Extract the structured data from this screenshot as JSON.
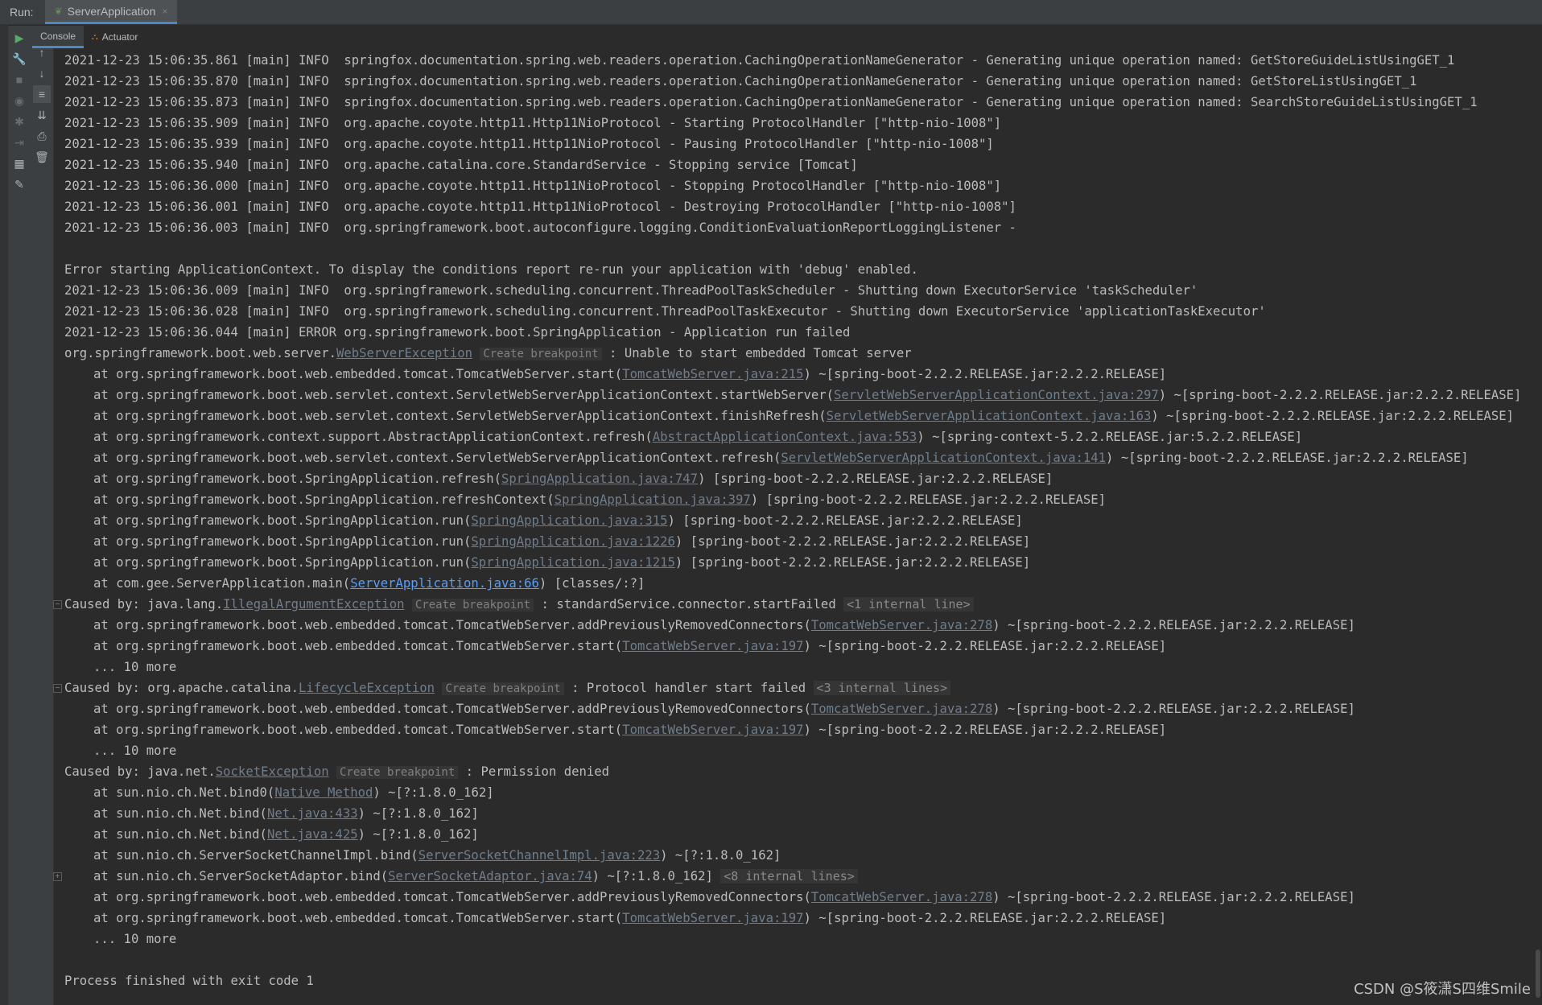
{
  "run": {
    "label": "Run:",
    "tab_title": "ServerApplication",
    "close_glyph": "×"
  },
  "subtabs": [
    {
      "label": "Console"
    },
    {
      "label": "Actuator"
    }
  ],
  "toolbar_icons": {
    "col1": [
      "run-icon",
      "wrench-icon",
      "stop-icon",
      "camera-icon",
      "debug-icon",
      "exit-icon",
      "layout-icon",
      "pin-icon"
    ],
    "col2": [
      "up-arrow-icon",
      "down-arrow-icon",
      "soft-wrap-icon",
      "scroll-to-end-icon",
      "print-icon",
      "trash-icon"
    ]
  },
  "console": {
    "lines": [
      {
        "t": "plain",
        "text": "2021-12-23 15:06:35.861 [main] INFO  springfox.documentation.spring.web.readers.operation.CachingOperationNameGenerator - Generating unique operation named: GetStoreGuideListUsingGET_1"
      },
      {
        "t": "plain",
        "text": "2021-12-23 15:06:35.870 [main] INFO  springfox.documentation.spring.web.readers.operation.CachingOperationNameGenerator - Generating unique operation named: GetStoreListUsingGET_1"
      },
      {
        "t": "plain",
        "text": "2021-12-23 15:06:35.873 [main] INFO  springfox.documentation.spring.web.readers.operation.CachingOperationNameGenerator - Generating unique operation named: SearchStoreGuideListUsingGET_1"
      },
      {
        "t": "plain",
        "text": "2021-12-23 15:06:35.909 [main] INFO  org.apache.coyote.http11.Http11NioProtocol - Starting ProtocolHandler [\"http-nio-1008\"]"
      },
      {
        "t": "plain",
        "text": "2021-12-23 15:06:35.939 [main] INFO  org.apache.coyote.http11.Http11NioProtocol - Pausing ProtocolHandler [\"http-nio-1008\"]"
      },
      {
        "t": "plain",
        "text": "2021-12-23 15:06:35.940 [main] INFO  org.apache.catalina.core.StandardService - Stopping service [Tomcat]"
      },
      {
        "t": "plain",
        "text": "2021-12-23 15:06:36.000 [main] INFO  org.apache.coyote.http11.Http11NioProtocol - Stopping ProtocolHandler [\"http-nio-1008\"]"
      },
      {
        "t": "plain",
        "text": "2021-12-23 15:06:36.001 [main] INFO  org.apache.coyote.http11.Http11NioProtocol - Destroying ProtocolHandler [\"http-nio-1008\"]"
      },
      {
        "t": "plain",
        "text": "2021-12-23 15:06:36.003 [main] INFO  org.springframework.boot.autoconfigure.logging.ConditionEvaluationReportLoggingListener -"
      },
      {
        "t": "plain",
        "text": ""
      },
      {
        "t": "plain",
        "text": "Error starting ApplicationContext. To display the conditions report re-run your application with 'debug' enabled."
      },
      {
        "t": "plain",
        "text": "2021-12-23 15:06:36.009 [main] INFO  org.springframework.scheduling.concurrent.ThreadPoolTaskScheduler - Shutting down ExecutorService 'taskScheduler'"
      },
      {
        "t": "plain",
        "text": "2021-12-23 15:06:36.028 [main] INFO  org.springframework.scheduling.concurrent.ThreadPoolTaskExecutor - Shutting down ExecutorService 'applicationTaskExecutor'"
      },
      {
        "t": "plain",
        "text": "2021-12-23 15:06:36.044 [main] ERROR org.springframework.boot.SpringApplication - Application run failed"
      },
      {
        "t": "exc",
        "pre": "org.springframework.boot.web.server.",
        "link": "WebServerException",
        "bp": "Create breakpoint",
        "post": " : Unable to start embedded Tomcat server"
      },
      {
        "t": "at",
        "pre": "at org.springframework.boot.web.embedded.tomcat.TomcatWebServer.start(",
        "link": "TomcatWebServer.java:215",
        "post": ") ~[spring-boot-2.2.2.RELEASE.jar:2.2.2.RELEASE]"
      },
      {
        "t": "at",
        "pre": "at org.springframework.boot.web.servlet.context.ServletWebServerApplicationContext.startWebServer(",
        "link": "ServletWebServerApplicationContext.java:297",
        "post": ") ~[spring-boot-2.2.2.RELEASE.jar:2.2.2.RELEASE]"
      },
      {
        "t": "at",
        "pre": "at org.springframework.boot.web.servlet.context.ServletWebServerApplicationContext.finishRefresh(",
        "link": "ServletWebServerApplicationContext.java:163",
        "post": ") ~[spring-boot-2.2.2.RELEASE.jar:2.2.2.RELEASE]"
      },
      {
        "t": "at",
        "pre": "at org.springframework.context.support.AbstractApplicationContext.refresh(",
        "link": "AbstractApplicationContext.java:553",
        "post": ") ~[spring-context-5.2.2.RELEASE.jar:5.2.2.RELEASE]"
      },
      {
        "t": "at",
        "pre": "at org.springframework.boot.web.servlet.context.ServletWebServerApplicationContext.refresh(",
        "link": "ServletWebServerApplicationContext.java:141",
        "post": ") ~[spring-boot-2.2.2.RELEASE.jar:2.2.2.RELEASE]"
      },
      {
        "t": "at",
        "pre": "at org.springframework.boot.SpringApplication.refresh(",
        "link": "SpringApplication.java:747",
        "post": ") [spring-boot-2.2.2.RELEASE.jar:2.2.2.RELEASE]"
      },
      {
        "t": "at",
        "pre": "at org.springframework.boot.SpringApplication.refreshContext(",
        "link": "SpringApplication.java:397",
        "post": ") [spring-boot-2.2.2.RELEASE.jar:2.2.2.RELEASE]"
      },
      {
        "t": "at",
        "pre": "at org.springframework.boot.SpringApplication.run(",
        "link": "SpringApplication.java:315",
        "post": ") [spring-boot-2.2.2.RELEASE.jar:2.2.2.RELEASE]"
      },
      {
        "t": "at",
        "pre": "at org.springframework.boot.SpringApplication.run(",
        "link": "SpringApplication.java:1226",
        "post": ") [spring-boot-2.2.2.RELEASE.jar:2.2.2.RELEASE]"
      },
      {
        "t": "at",
        "pre": "at org.springframework.boot.SpringApplication.run(",
        "link": "SpringApplication.java:1215",
        "post": ") [spring-boot-2.2.2.RELEASE.jar:2.2.2.RELEASE]"
      },
      {
        "t": "at",
        "pre": "at com.gee.ServerApplication.main(",
        "link": "ServerApplication.java:66",
        "post": ") [classes/:?]",
        "blue": true
      },
      {
        "t": "exc",
        "fold": "−",
        "pre": "Caused by: java.lang.",
        "link": "IllegalArgumentException",
        "bp": "Create breakpoint",
        "post": " : standardService.connector.startFailed ",
        "internal": "<1 internal line>"
      },
      {
        "t": "at",
        "pre": "at org.springframework.boot.web.embedded.tomcat.TomcatWebServer.addPreviouslyRemovedConnectors(",
        "link": "TomcatWebServer.java:278",
        "post": ") ~[spring-boot-2.2.2.RELEASE.jar:2.2.2.RELEASE]"
      },
      {
        "t": "at",
        "pre": "at org.springframework.boot.web.embedded.tomcat.TomcatWebServer.start(",
        "link": "TomcatWebServer.java:197",
        "post": ") ~[spring-boot-2.2.2.RELEASE.jar:2.2.2.RELEASE]"
      },
      {
        "t": "at",
        "pre": "... 10 more"
      },
      {
        "t": "exc",
        "fold": "−",
        "pre": "Caused by: org.apache.catalina.",
        "link": "LifecycleException",
        "bp": "Create breakpoint",
        "post": " : Protocol handler start failed ",
        "internal": "<3 internal lines>"
      },
      {
        "t": "at",
        "pre": "at org.springframework.boot.web.embedded.tomcat.TomcatWebServer.addPreviouslyRemovedConnectors(",
        "link": "TomcatWebServer.java:278",
        "post": ") ~[spring-boot-2.2.2.RELEASE.jar:2.2.2.RELEASE]"
      },
      {
        "t": "at",
        "pre": "at org.springframework.boot.web.embedded.tomcat.TomcatWebServer.start(",
        "link": "TomcatWebServer.java:197",
        "post": ") ~[spring-boot-2.2.2.RELEASE.jar:2.2.2.RELEASE]"
      },
      {
        "t": "at",
        "pre": "... 10 more"
      },
      {
        "t": "exc",
        "pre": "Caused by: java.net.",
        "link": "SocketException",
        "bp": "Create breakpoint",
        "post": " : Permission denied"
      },
      {
        "t": "at",
        "pre": "at sun.nio.ch.Net.bind0(",
        "link": "Native Method",
        "post": ") ~[?:1.8.0_162]"
      },
      {
        "t": "at",
        "pre": "at sun.nio.ch.Net.bind(",
        "link": "Net.java:433",
        "post": ") ~[?:1.8.0_162]"
      },
      {
        "t": "at",
        "pre": "at sun.nio.ch.Net.bind(",
        "link": "Net.java:425",
        "post": ") ~[?:1.8.0_162]"
      },
      {
        "t": "at",
        "pre": "at sun.nio.ch.ServerSocketChannelImpl.bind(",
        "link": "ServerSocketChannelImpl.java:223",
        "post": ") ~[?:1.8.0_162]"
      },
      {
        "t": "at",
        "fold": "+",
        "pre": "at sun.nio.ch.ServerSocketAdaptor.bind(",
        "link": "ServerSocketAdaptor.java:74",
        "post": ") ~[?:1.8.0_162] ",
        "internal": "<8 internal lines>"
      },
      {
        "t": "at",
        "pre": "at org.springframework.boot.web.embedded.tomcat.TomcatWebServer.addPreviouslyRemovedConnectors(",
        "link": "TomcatWebServer.java:278",
        "post": ") ~[spring-boot-2.2.2.RELEASE.jar:2.2.2.RELEASE]"
      },
      {
        "t": "at",
        "pre": "at org.springframework.boot.web.embedded.tomcat.TomcatWebServer.start(",
        "link": "TomcatWebServer.java:197",
        "post": ") ~[spring-boot-2.2.2.RELEASE.jar:2.2.2.RELEASE]"
      },
      {
        "t": "at",
        "pre": "... 10 more"
      },
      {
        "t": "plain",
        "text": ""
      },
      {
        "t": "plain",
        "text": "Process finished with exit code 1"
      }
    ]
  },
  "watermark": "CSDN @S筱潇S四维Smile"
}
